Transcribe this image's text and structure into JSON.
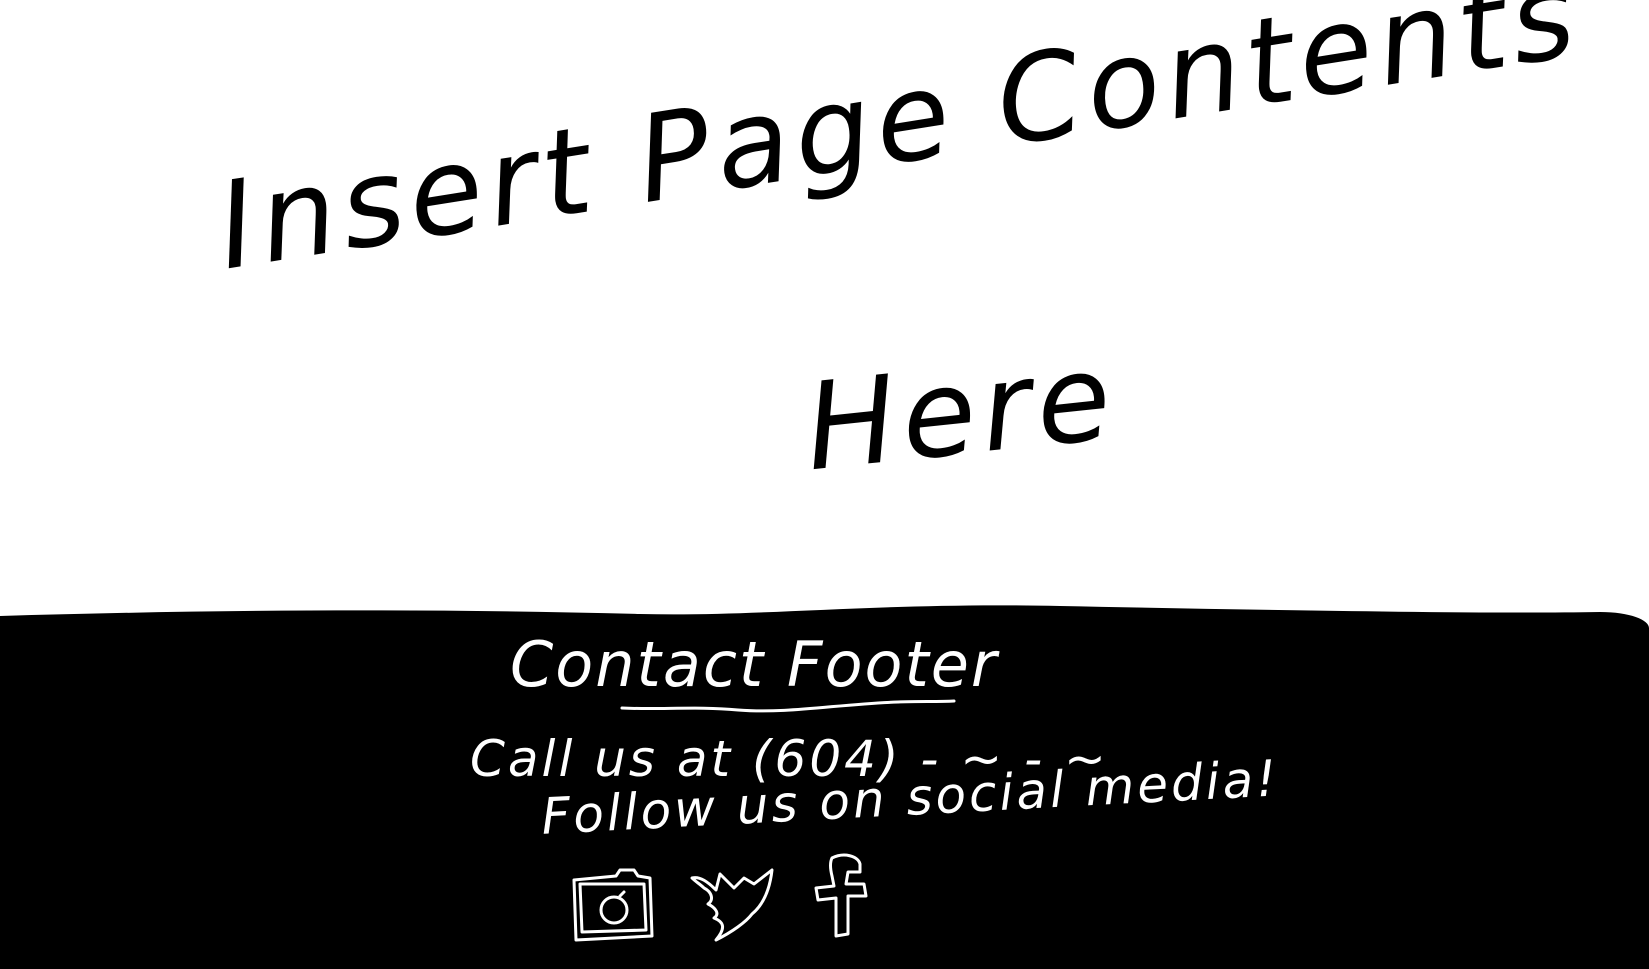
{
  "main": {
    "line1": "Insert Page Contents",
    "line2": "Here"
  },
  "footer": {
    "title": "Contact Footer",
    "call_text": "Call us at (604) - ~ - ~",
    "follow_text": "Follow us on social media!"
  },
  "icons": {
    "instagram": "instagram-icon",
    "twitter": "twitter-icon",
    "facebook": "facebook-icon"
  },
  "colors": {
    "background": "#ffffff",
    "footer": "#000000",
    "ink": "#000000",
    "footer_ink": "#ffffff"
  }
}
